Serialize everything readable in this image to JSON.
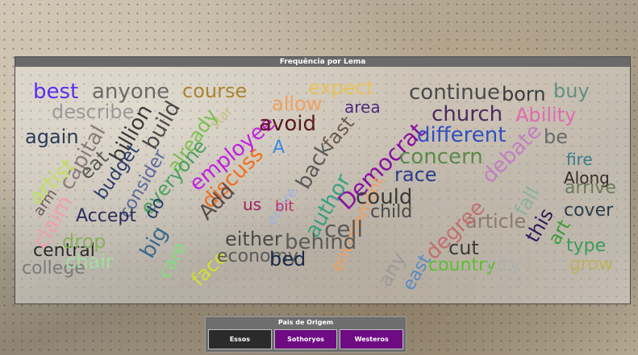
{
  "panel": {
    "title": "Frequência por Lema"
  },
  "slicer": {
    "title": "Pais de Origem",
    "options": [
      {
        "label": "Essos",
        "selected": false,
        "color": "#2b2b2b"
      },
      {
        "label": "Sothoryos",
        "selected": true,
        "color": "#6e0a82"
      },
      {
        "label": "Westeros",
        "selected": true,
        "color": "#6e0a82"
      }
    ]
  },
  "words": [
    {
      "text": "best",
      "color": "#5a2df0"
    },
    {
      "text": "anyone",
      "color": "#6a6a6a"
    },
    {
      "text": "course",
      "color": "#a98530"
    },
    {
      "text": "expect",
      "color": "#e8c25a"
    },
    {
      "text": "continue",
      "color": "#4a4a4a"
    },
    {
      "text": "born",
      "color": "#3b3b3b"
    },
    {
      "text": "buy",
      "color": "#5f8f80"
    },
    {
      "text": "describe",
      "color": "#9a9a9a"
    },
    {
      "text": "allow",
      "color": "#f0a060"
    },
    {
      "text": "area",
      "color": "#4a2b7a"
    },
    {
      "text": "church",
      "color": "#4a2b5a"
    },
    {
      "text": "Ability",
      "color": "#e06ab0"
    },
    {
      "text": "again",
      "color": "#2b3b5a"
    },
    {
      "text": "capital",
      "color": "#8a7a7a"
    },
    {
      "text": "billion",
      "color": "#3a3a3a"
    },
    {
      "text": "build",
      "color": "#4a4a4a"
    },
    {
      "text": "already",
      "color": "#7ac050"
    },
    {
      "text": "star",
      "color": "#c0c080"
    },
    {
      "text": "employee",
      "color": "#c020e0"
    },
    {
      "text": "avoid",
      "color": "#5a1a1a"
    },
    {
      "text": "fast",
      "color": "#6a5a4a"
    },
    {
      "text": "Democrat",
      "color": "#8a10a0"
    },
    {
      "text": "different",
      "color": "#3050c0"
    },
    {
      "text": "be",
      "color": "#6a6a6a"
    },
    {
      "text": "artist",
      "color": "#c0e060"
    },
    {
      "text": "eat",
      "color": "#5a5a5a"
    },
    {
      "text": "budget",
      "color": "#2b3b6a"
    },
    {
      "text": "everyone",
      "color": "#4aa060"
    },
    {
      "text": "discuss",
      "color": "#f07020"
    },
    {
      "text": "A",
      "color": "#3a8ae0"
    },
    {
      "text": "back",
      "color": "#5a5a5a"
    },
    {
      "text": "concern",
      "color": "#5a8a4a"
    },
    {
      "text": "debate",
      "color": "#c080c0"
    },
    {
      "text": "fire",
      "color": "#3a7a8a"
    },
    {
      "text": "race",
      "color": "#2b3b8a"
    },
    {
      "text": "Along",
      "color": "#3a2a2a"
    },
    {
      "text": "arm",
      "color": "#6a5a5a"
    },
    {
      "text": "claim",
      "color": "#f0a0b0"
    },
    {
      "text": "consider",
      "color": "#5a6a9a"
    },
    {
      "text": "do",
      "color": "#2b3b6a"
    },
    {
      "text": "Add",
      "color": "#5a4a4a"
    },
    {
      "text": "entire",
      "color": "#a0b0e0"
    },
    {
      "text": "author",
      "color": "#3aa080"
    },
    {
      "text": "fall",
      "color": "#8ab0a0"
    },
    {
      "text": "arrive",
      "color": "#6a7a5a"
    },
    {
      "text": "Accept",
      "color": "#2b2b5a"
    },
    {
      "text": "big",
      "color": "#3a6a8a"
    },
    {
      "text": "us",
      "color": "#a02060"
    },
    {
      "text": "bit",
      "color": "#c03060"
    },
    {
      "text": "environment",
      "color": "#f0a060"
    },
    {
      "text": "could",
      "color": "#3a3a3a"
    },
    {
      "text": "this",
      "color": "#2b1a5a"
    },
    {
      "text": "cover",
      "color": "#2b3b4a"
    },
    {
      "text": "child",
      "color": "#4a4a4a"
    },
    {
      "text": "article",
      "color": "#8a7a6a"
    },
    {
      "text": "degree",
      "color": "#c07070"
    },
    {
      "text": "cell",
      "color": "#5a5a5a"
    },
    {
      "text": "art",
      "color": "#3a9a3a"
    },
    {
      "text": "central",
      "color": "#2b2b2b"
    },
    {
      "text": "drop",
      "color": "#8ab060"
    },
    {
      "text": "care",
      "color": "#80e080"
    },
    {
      "text": "face",
      "color": "#d0e030"
    },
    {
      "text": "either",
      "color": "#4a4a4a"
    },
    {
      "text": "behind",
      "color": "#5a5a5a"
    },
    {
      "text": "cut",
      "color": "#3a3a3a"
    },
    {
      "text": "type",
      "color": "#3a9a5a"
    },
    {
      "text": "college",
      "color": "#7a7a7a"
    },
    {
      "text": "chair",
      "color": "#a0e0a0"
    },
    {
      "text": "economy",
      "color": "#5a5a5a"
    },
    {
      "text": "bed",
      "color": "#1a2a4a"
    },
    {
      "text": "any",
      "color": "#9a9a9a"
    },
    {
      "text": "east",
      "color": "#5a8ac0"
    },
    {
      "text": "country",
      "color": "#5ac030"
    },
    {
      "text": "city",
      "color": "#b0b0b0"
    },
    {
      "text": "grow",
      "color": "#c0b060"
    }
  ]
}
